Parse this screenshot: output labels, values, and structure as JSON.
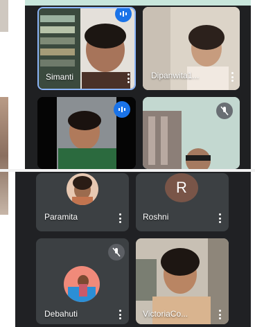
{
  "participants": {
    "simanti": {
      "name": "Simanti"
    },
    "dipanwita": {
      "name": "Dipanwita1..."
    },
    "paramita": {
      "name": "Paramita"
    },
    "roshni": {
      "name": "Roshni",
      "initial": "R"
    },
    "debahuti": {
      "name": "Debahuti"
    },
    "victoria": {
      "name": "VictoriaCo..."
    }
  },
  "colors": {
    "panel": "#202124",
    "tile": "#3c4043",
    "active_speaker_border": "#8ab4f8",
    "speaking_badge": "#1a73e8",
    "roshni_avatar": "#795548"
  },
  "icons": [
    "more-vert-icon",
    "mic-off-icon",
    "audio-level-icon"
  ]
}
